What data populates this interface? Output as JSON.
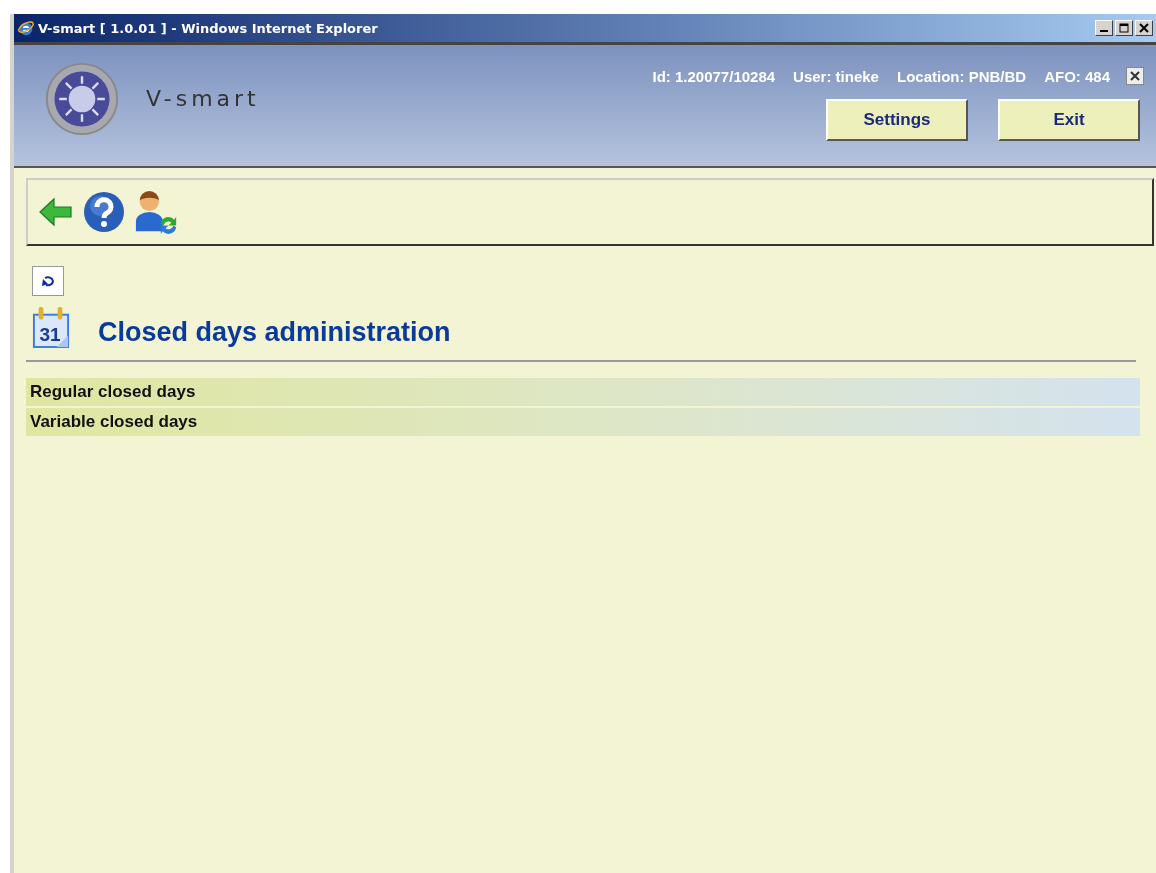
{
  "window": {
    "title": "V-smart [ 1.0.01 ] - Windows Internet Explorer"
  },
  "header": {
    "app_name": "V-smart",
    "info": [
      "Id: 1.20077/10284",
      "User: tineke",
      "Location: PNB/BD",
      "AFO: 484"
    ],
    "buttons": [
      "Settings",
      "Exit"
    ]
  },
  "page": {
    "title": "Closed days administration",
    "title_icon_label": "31",
    "items": [
      "Regular closed days",
      "Variable closed days"
    ]
  }
}
